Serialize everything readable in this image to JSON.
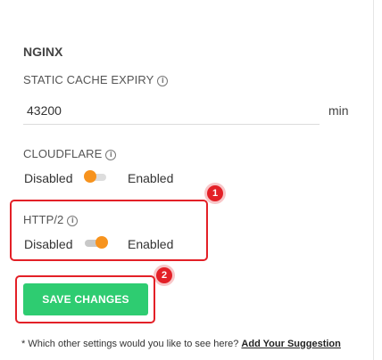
{
  "section": {
    "title": "NGINX"
  },
  "static_cache": {
    "label": "STATIC CACHE EXPIRY",
    "info_icon": "info-icon",
    "value": "43200",
    "unit": "min"
  },
  "cloudflare": {
    "label": "CLOUDFLARE",
    "info_icon": "info-icon",
    "off_label": "Disabled",
    "on_label": "Enabled",
    "state": "disabled"
  },
  "http2": {
    "label": "HTTP/2",
    "info_icon": "info-icon",
    "off_label": "Disabled",
    "on_label": "Enabled",
    "state": "enabled"
  },
  "annotations": {
    "step1": "1",
    "step2": "2",
    "color": "#e32027"
  },
  "actions": {
    "save_label": "SAVE CHANGES",
    "save_color": "#2ecc71"
  },
  "footer": {
    "note": "* Which other settings would you like to see here?",
    "link_label": "Add Your Suggestion"
  },
  "colors": {
    "toggle_knob": "#f7931e"
  }
}
